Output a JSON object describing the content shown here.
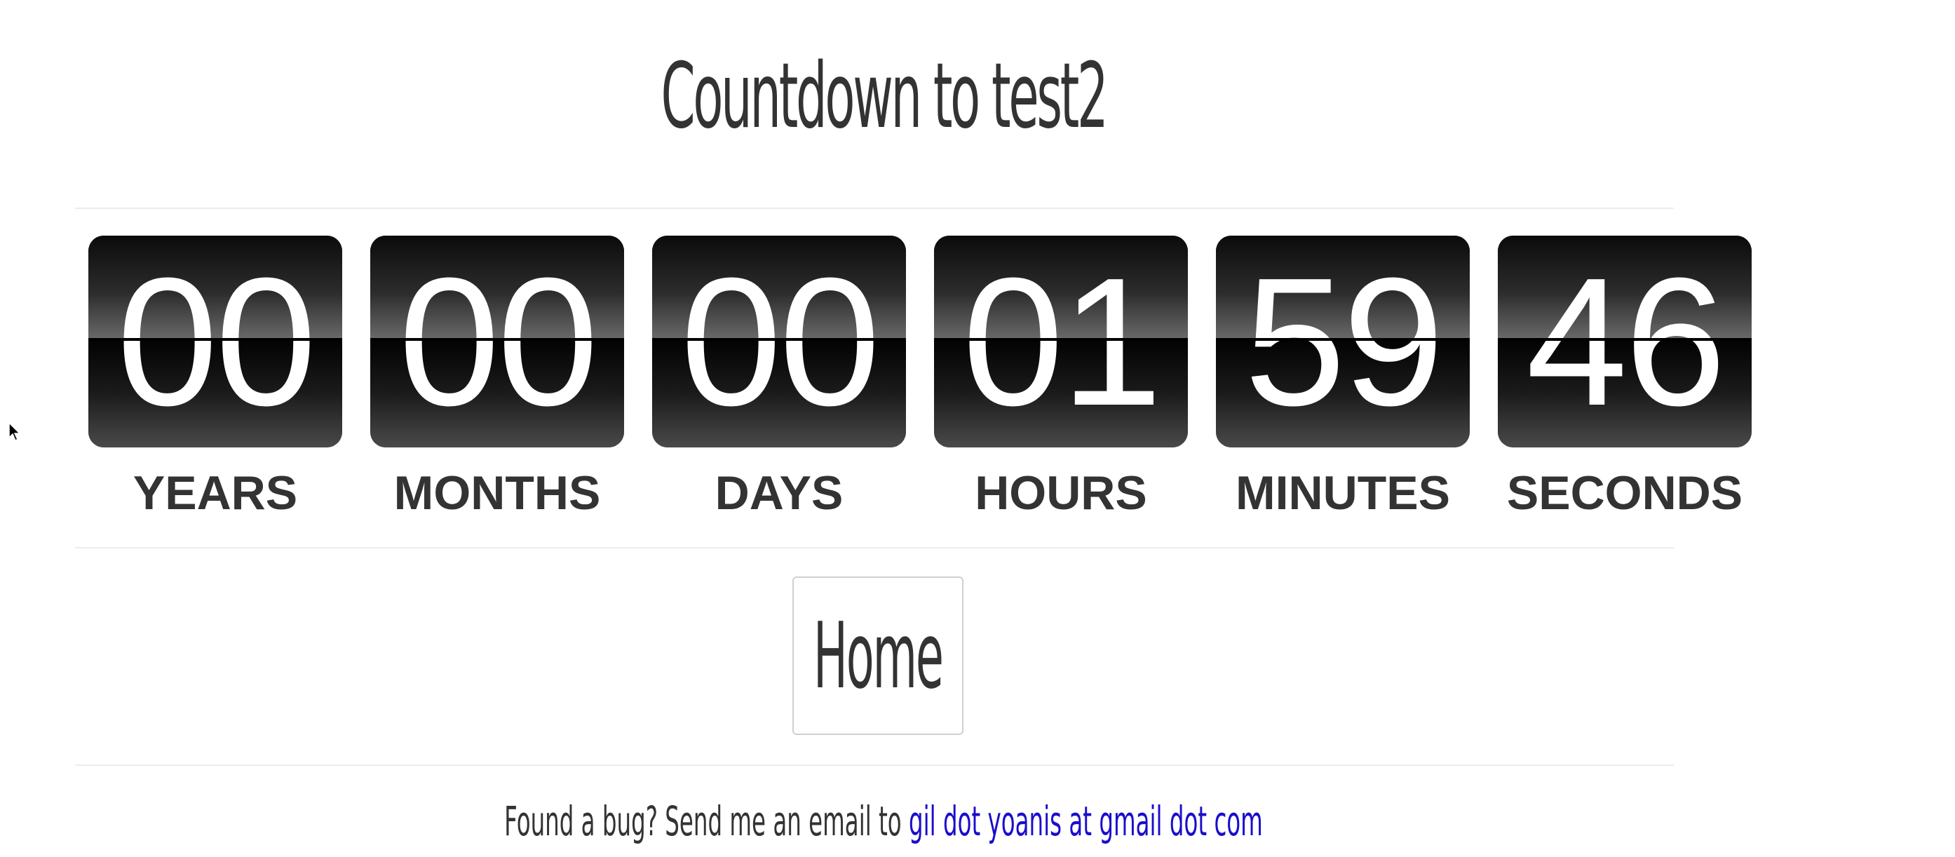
{
  "title": "Countdown to test2",
  "countdown": [
    {
      "value": "00",
      "label": "YEARS"
    },
    {
      "value": "00",
      "label": "MONTHS"
    },
    {
      "value": "00",
      "label": "DAYS"
    },
    {
      "value": "01",
      "label": "HOURS"
    },
    {
      "value": "59",
      "label": "MINUTES"
    },
    {
      "value": "46",
      "label": "SECONDS"
    }
  ],
  "home_button": {
    "label": "Home"
  },
  "footer": {
    "text": "Found a bug? Send me an email to ",
    "link_text": "gil dot yoanis at gmail dot com"
  },
  "colors": {
    "text": "#333333",
    "link": "#1a0dcc",
    "card": "#111111",
    "digit": "#ffffff"
  }
}
